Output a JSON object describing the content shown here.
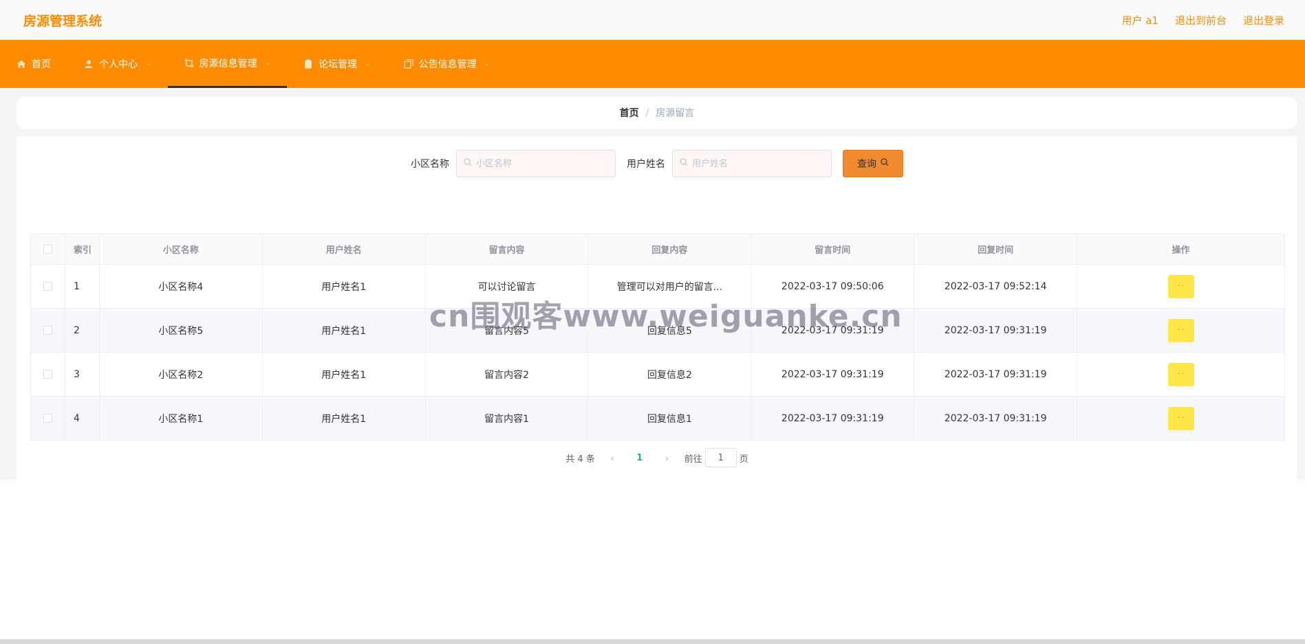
{
  "header": {
    "title": "房源管理系统",
    "user_label": "用户 a1",
    "to_front_label": "退出到前台",
    "logout_label": "退出登录"
  },
  "nav": {
    "items": [
      {
        "label": "首页",
        "icon": "home-icon"
      },
      {
        "label": "个人中心",
        "icon": "user-icon"
      },
      {
        "label": "房源信息管理",
        "icon": "crop-icon"
      },
      {
        "label": "论坛管理",
        "icon": "clipboard-icon"
      },
      {
        "label": "公告信息管理",
        "icon": "copy-icon"
      }
    ],
    "active_index": 2
  },
  "breadcrumb": {
    "home": "首页",
    "current": "房源留言"
  },
  "search": {
    "field1_label": "小区名称",
    "field1_placeholder": "小区名称",
    "field2_label": "用户姓名",
    "field2_placeholder": "用户姓名",
    "query_label": "查询"
  },
  "table": {
    "headers": [
      "索引",
      "小区名称",
      "用户姓名",
      "留言内容",
      "回复内容",
      "留言时间",
      "回复时间",
      "操作"
    ],
    "rows": [
      {
        "index": "1",
        "community": "小区名称4",
        "user": "用户姓名1",
        "message": "可以讨论留言",
        "reply": "管理可以对用户的留言...",
        "msg_time": "2022-03-17 09:50:06",
        "reply_time": "2022-03-17 09:52:14",
        "op": "· ·"
      },
      {
        "index": "2",
        "community": "小区名称5",
        "user": "用户姓名1",
        "message": "留言内容5",
        "reply": "回复信息5",
        "msg_time": "2022-03-17 09:31:19",
        "reply_time": "2022-03-17 09:31:19",
        "op": "· ·"
      },
      {
        "index": "3",
        "community": "小区名称2",
        "user": "用户姓名1",
        "message": "留言内容2",
        "reply": "回复信息2",
        "msg_time": "2022-03-17 09:31:19",
        "reply_time": "2022-03-17 09:31:19",
        "op": "· ·"
      },
      {
        "index": "4",
        "community": "小区名称1",
        "user": "用户姓名1",
        "message": "留言内容1",
        "reply": "回复信息1",
        "msg_time": "2022-03-17 09:31:19",
        "reply_time": "2022-03-17 09:31:19",
        "op": "· ·"
      }
    ]
  },
  "pagination": {
    "total_text": "共 4 条",
    "current_page": "1",
    "goto_label": "前往",
    "goto_value": "1",
    "page_suffix": "页"
  },
  "watermark": "cn围观客www.weiguanke.cn",
  "colors": {
    "accent": "#ff8c00",
    "query_button": "#f08a2e",
    "op_button": "#ffe74a",
    "current_page": "#1ab394"
  }
}
